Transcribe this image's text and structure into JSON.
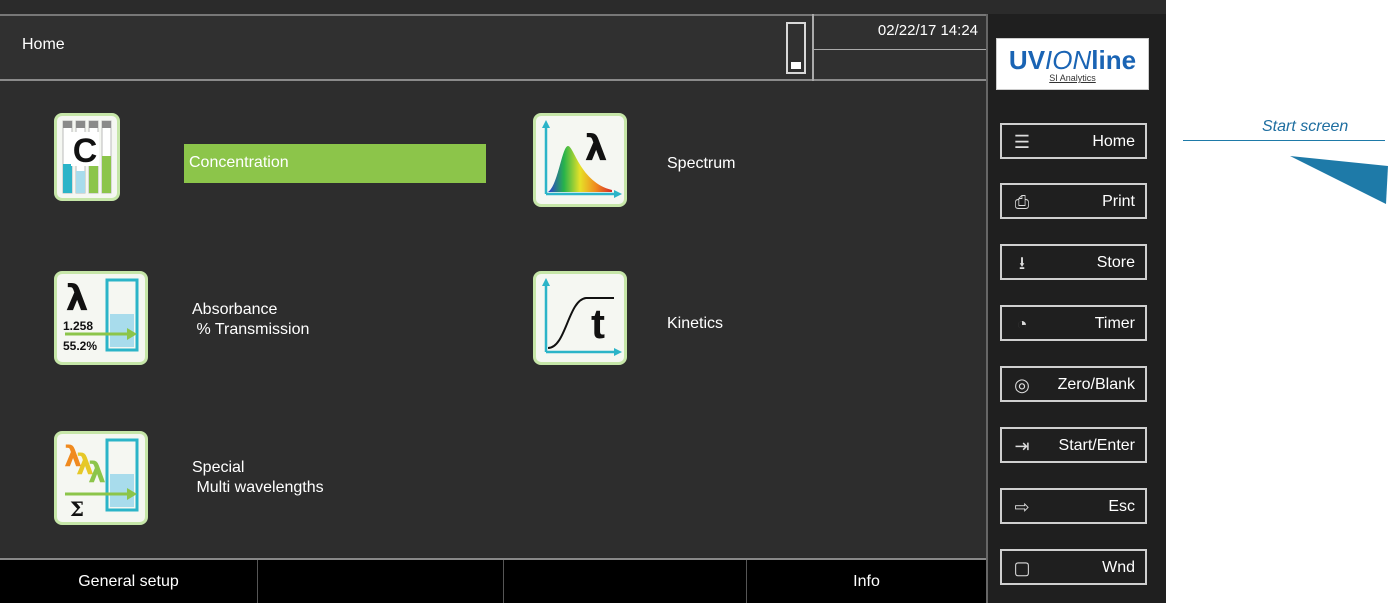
{
  "header": {
    "title": "Home",
    "datetime": "02/22/17 14:24"
  },
  "menu": [
    {
      "id": "concentration",
      "label": "Concentration",
      "selected": true,
      "icon": "concentration-icon"
    },
    {
      "id": "spectrum",
      "label": "Spectrum",
      "selected": false,
      "icon": "spectrum-icon"
    },
    {
      "id": "absorbance",
      "label": "Absorbance\n % Transmission",
      "selected": false,
      "icon": "absorbance-icon",
      "icon_values": [
        "1.258",
        "55.2%"
      ]
    },
    {
      "id": "kinetics",
      "label": "Kinetics",
      "selected": false,
      "icon": "kinetics-icon"
    },
    {
      "id": "special",
      "label": "Special\n Multi wavelengths",
      "selected": false,
      "icon": "special-icon"
    }
  ],
  "icon_glyphs": {
    "concentration": "C",
    "spectrum": "λ",
    "absorbance": "λ",
    "kinetics": "t",
    "special": "Σ"
  },
  "footer": {
    "keys": [
      "General setup",
      "",
      "",
      "Info"
    ]
  },
  "side": {
    "logo": {
      "brand": "UVIONline",
      "brand_prefix": "UV",
      "brand_italic": "ION",
      "brand_suffix": "line",
      "sub": "SI Analytics"
    },
    "buttons": [
      {
        "label": "Home",
        "icon": "menu-lines-icon"
      },
      {
        "label": "Print",
        "icon": "printer-icon"
      },
      {
        "label": "Store",
        "icon": "download-icon"
      },
      {
        "label": "Timer",
        "icon": "timer-icon"
      },
      {
        "label": "Zero/Blank",
        "icon": "target-icon"
      },
      {
        "label": "Start/Enter",
        "icon": "enter-icon"
      },
      {
        "label": "Esc",
        "icon": "exit-icon"
      },
      {
        "label": "Wnd",
        "icon": "window-icon"
      }
    ]
  },
  "annotation": {
    "text": "Start screen"
  },
  "colors": {
    "accent": "#8cc54a",
    "annotation": "#1e7aa8",
    "brand": "#1a64b4"
  }
}
